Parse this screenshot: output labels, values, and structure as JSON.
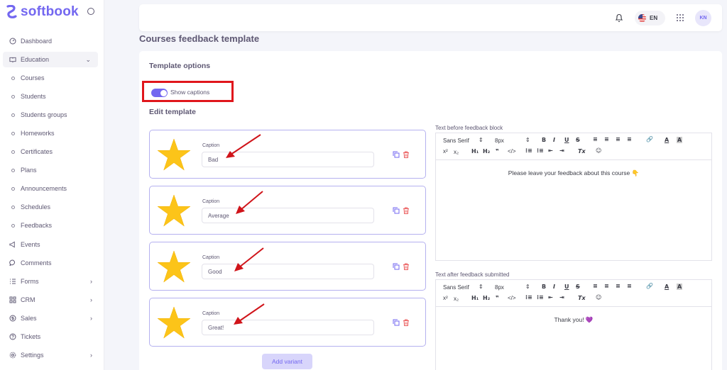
{
  "brand": {
    "name": "softbook",
    "color": "#7367f0"
  },
  "sidebar": {
    "items": [
      {
        "label": "Dashboard",
        "icon": "dashboard-icon"
      },
      {
        "label": "Education",
        "icon": "book-icon"
      },
      {
        "label": "Courses",
        "icon": "dot-icon"
      },
      {
        "label": "Students",
        "icon": "dot-icon"
      },
      {
        "label": "Students groups",
        "icon": "dot-icon"
      },
      {
        "label": "Homeworks",
        "icon": "dot-icon"
      },
      {
        "label": "Certificates",
        "icon": "dot-icon"
      },
      {
        "label": "Plans",
        "icon": "dot-icon"
      },
      {
        "label": "Announcements",
        "icon": "dot-icon"
      },
      {
        "label": "Schedules",
        "icon": "dot-icon"
      },
      {
        "label": "Feedbacks",
        "icon": "dot-icon"
      },
      {
        "label": "Events",
        "icon": "megaphone-icon"
      },
      {
        "label": "Comments",
        "icon": "comment-icon"
      },
      {
        "label": "Forms",
        "icon": "list-icon"
      },
      {
        "label": "CRM",
        "icon": "grid-icon"
      },
      {
        "label": "Sales",
        "icon": "dollar-icon"
      },
      {
        "label": "Tickets",
        "icon": "help-icon"
      },
      {
        "label": "Settings",
        "icon": "gear-icon"
      }
    ]
  },
  "topbar": {
    "lang": "EN",
    "avatar": "KN"
  },
  "page": {
    "title": "Courses feedback template",
    "template_options": "Template options",
    "show_captions": "Show captions",
    "show_captions_on": true,
    "edit_template": "Edit template",
    "caption_label": "Caption",
    "variants": [
      {
        "caption": "Bad"
      },
      {
        "caption": "Average"
      },
      {
        "caption": "Good"
      },
      {
        "caption": "Great!"
      }
    ],
    "add_variant": "Add variant"
  },
  "editors": {
    "before": {
      "label": "Text before feedback block",
      "font": "Sans Serif",
      "size": "8px",
      "content": "Please leave your feedback about this course 👇"
    },
    "after": {
      "label": "Text after feedback submitted",
      "font": "Sans Serif",
      "size": "8px",
      "content": "Thank you! 💜"
    }
  }
}
